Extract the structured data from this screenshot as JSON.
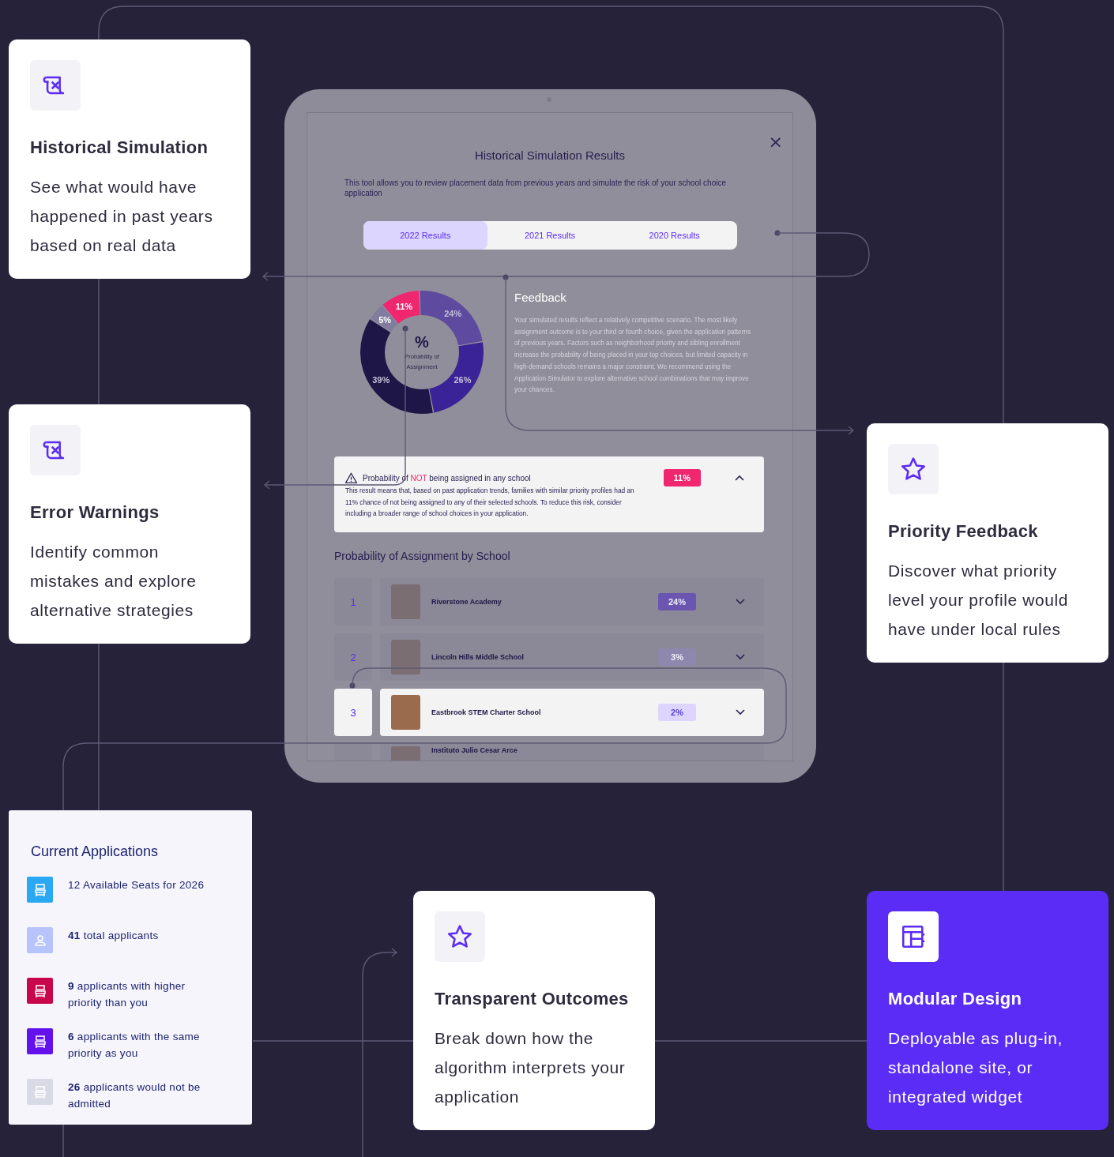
{
  "features_left": [
    {
      "kind": "scroll",
      "title": "Historical Simulation",
      "body": "See what would have happened in past years based on real data",
      "accent": false
    },
    {
      "kind": "scroll",
      "title": "Error Warnings",
      "body": "Identify common mistakes and explore alternative strategies",
      "accent": false
    }
  ],
  "features_right": [
    {
      "kind": "star",
      "title": "Priority Feedback",
      "body": "Discover what priority level your profile would have under local rules",
      "accent": false
    }
  ],
  "features_bottom": [
    {
      "kind": "star",
      "title": "Transparent Outcomes",
      "body": "Break down how the algorithm interprets your application",
      "accent": false
    },
    {
      "kind": "layout",
      "title": "Modular Design",
      "body": "Deployable as plug-in, standalone site, or integrated widget",
      "accent": true
    }
  ],
  "current_applications": {
    "title": "Current Applications",
    "items": [
      {
        "kind": "seat",
        "color": "#2aa8f2",
        "text": "12 Available Seats for 2026"
      },
      {
        "kind": "person",
        "color": "#b7c4fb",
        "text": "**41** total applicants"
      },
      {
        "kind": "seat",
        "color": "#c9064b",
        "text": "**9** applicants with higher priority than you"
      },
      {
        "kind": "seat",
        "color": "#6411ee",
        "text": "**6** applicants with the same priority as you"
      },
      {
        "kind": "seat",
        "color": "#d8dbe6",
        "text": "**26** applicants would not be admitted"
      }
    ]
  },
  "dialog": {
    "title": "Historical Simulation Results",
    "close": "×",
    "description": "This tool allows you to review placement data from previous years and simulate the risk of your school choice application",
    "tabs": [
      {
        "label": "2022 Results",
        "selected": true
      },
      {
        "label": "2021 Results",
        "selected": false
      },
      {
        "label": "2020 Results",
        "selected": false
      }
    ],
    "chart": {
      "center_symbol": "%",
      "center_label": "Probability of Assignment",
      "chart_data": {
        "type": "donut",
        "values": [
          11,
          24,
          26,
          39,
          5
        ],
        "value_labels": [
          "11%",
          "24%",
          "26%",
          "39%",
          "5%"
        ],
        "colors": [
          "#f0266e",
          "#5e4a9e",
          "#3a2396",
          "#1e1646",
          "#827d9e"
        ]
      }
    },
    "feedback": {
      "title": "Feedback",
      "body": "Your simulated results reflect a relatively competitive scenario. The most likely assignment outcome is to your third or fourth choice, given the application patterns of previous years. Factors such as neighborhood priority and sibling enrollment increase the probability of being placed in your top choices, but limited capacity in high-demand schools remains a major constraint. We recommend using the Application Simulator to explore alternative school combinations that may improve your chances."
    },
    "alert": {
      "title_before": "Probability of ",
      "title_highlight": "NOT",
      "title_after": " being assigned in any school",
      "badge": "11%",
      "expanded": true,
      "body": "This result means that, based on past application trends, families with similar priority profiles had an 11% chance of not being assigned to any of their selected schools.  To reduce this risk, consider including a broader range of school choices in your application."
    },
    "schools_title": "Probability of Assignment by School",
    "schools": [
      {
        "rank": "1",
        "name": "Riverstone Academy",
        "percent": "24%",
        "color": "#6a55b0",
        "selected": false
      },
      {
        "rank": "2",
        "name": "Lincoln Hills Middle School",
        "percent": "3%",
        "color": "#8f88ae",
        "selected": false
      },
      {
        "rank": "3",
        "name": "Eastbrook STEM Charter School",
        "percent": "2%",
        "color": "#ddd5fd",
        "selected": true
      },
      {
        "name": "Instituto Julio Cesar Arce",
        "selected": false
      }
    ]
  }
}
